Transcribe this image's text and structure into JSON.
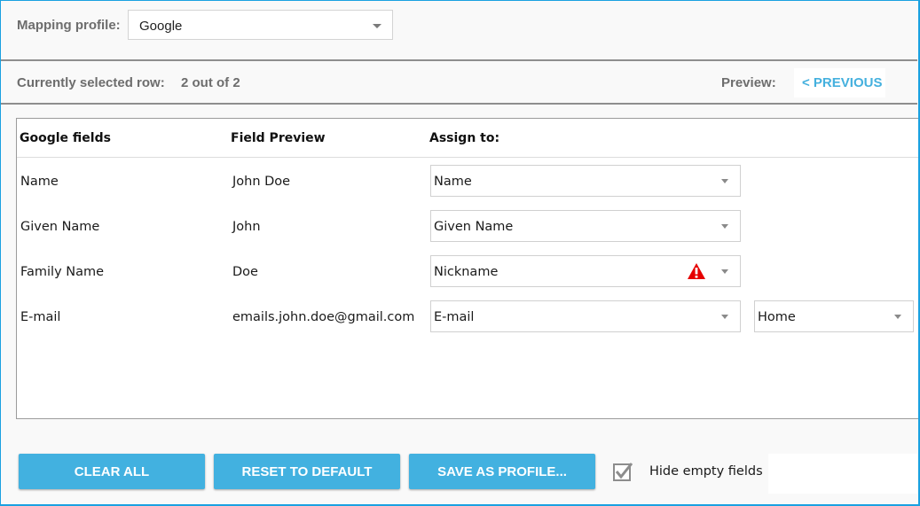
{
  "profile": {
    "label": "Mapping profile:",
    "selected": "Google"
  },
  "status_bar": {
    "selected_row_label": "Currently selected row:",
    "selected_row_value": "2 out of 2",
    "preview_label": "Preview:",
    "previous_link": "< PREVIOUS"
  },
  "table": {
    "headers": [
      "Google fields",
      "Field Preview",
      "Assign to:"
    ],
    "rows": [
      {
        "field": "Name",
        "preview": "John Doe",
        "assign": "Name",
        "warning": false
      },
      {
        "field": "Given Name",
        "preview": "John",
        "assign": "Given Name",
        "warning": false
      },
      {
        "field": "Family Name",
        "preview": "Doe",
        "assign": "Nickname",
        "warning": true
      },
      {
        "field": "E-mail",
        "preview": "emails.john.doe@gmail.com",
        "assign": "E-mail",
        "warning": false,
        "subtype": "Home"
      }
    ]
  },
  "footer": {
    "clear_all": "CLEAR ALL",
    "reset_default": "RESET TO DEFAULT",
    "save_profile": "SAVE AS PROFILE...",
    "hide_empty_label": "Hide empty fields",
    "hide_empty_checked": true
  },
  "colors": {
    "accent": "#42b1e0",
    "link": "#44b0de",
    "warning": "#e60000",
    "frame": "#1aa1e1"
  },
  "icons": {
    "dropdown": "caret-down",
    "warning": "warning-triangle",
    "checkbox": "checkmark"
  }
}
